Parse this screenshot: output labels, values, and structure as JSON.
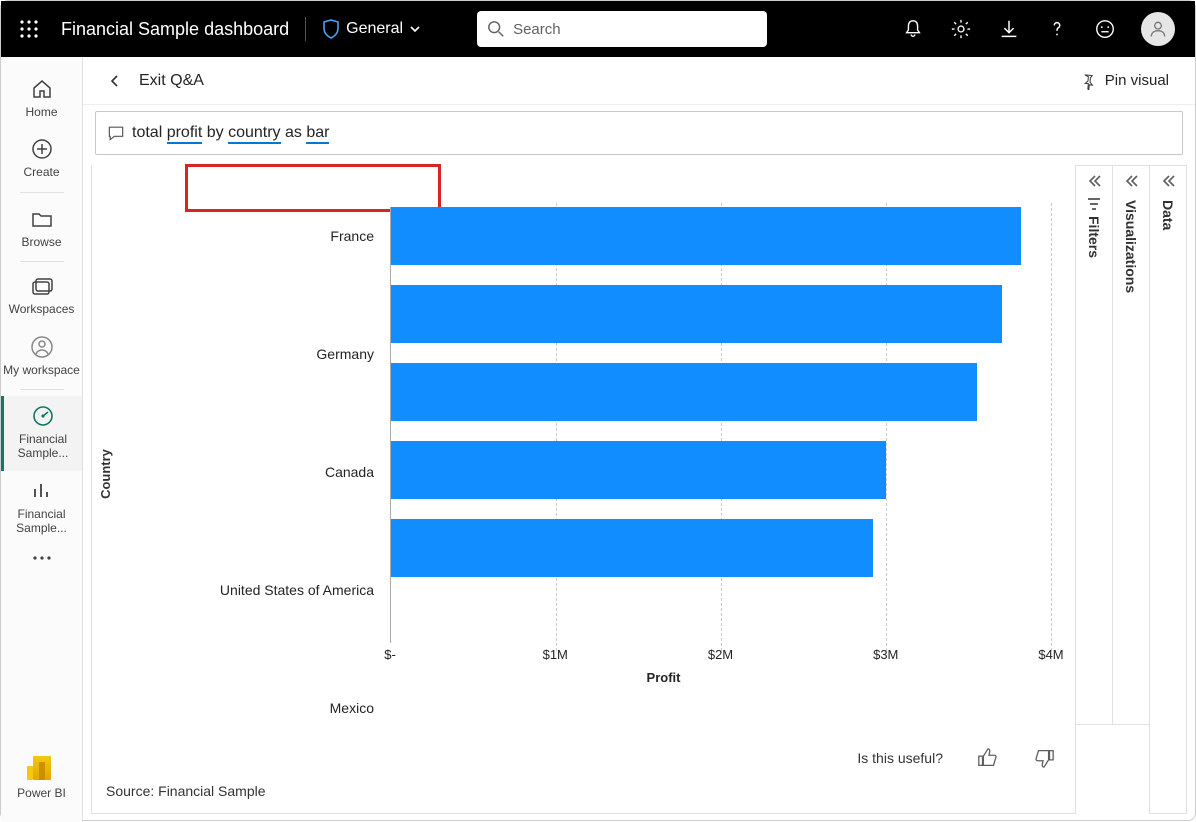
{
  "header": {
    "title": "Financial Sample dashboard",
    "sensitivity_label": "General",
    "search_placeholder": "Search"
  },
  "leftnav": {
    "items": [
      {
        "label": "Home"
      },
      {
        "label": "Create"
      },
      {
        "label": "Browse"
      },
      {
        "label": "Workspaces"
      },
      {
        "label": "My workspace"
      },
      {
        "label": "Financial Sample..."
      },
      {
        "label": "Financial Sample..."
      }
    ],
    "footer_label": "Power BI"
  },
  "subheader": {
    "exit_label": "Exit Q&A",
    "pin_label": "Pin visual"
  },
  "qna": {
    "tokens": [
      "total ",
      "profit",
      " by ",
      "country",
      " as ",
      "bar"
    ]
  },
  "right_panes": {
    "filters": "Filters",
    "viz": "Visualizations",
    "data": "Data"
  },
  "feedback": {
    "prompt": "Is this useful?"
  },
  "source_line": "Source: Financial Sample",
  "chart_data": {
    "type": "bar",
    "orientation": "horizontal",
    "ylabel": "Country",
    "xlabel": "Profit",
    "xlim": [
      0,
      4000000
    ],
    "xticks": [
      "$-",
      "$1M",
      "$2M",
      "$3M",
      "$4M"
    ],
    "categories": [
      "France",
      "Germany",
      "Canada",
      "United States of America",
      "Mexico"
    ],
    "values": [
      3820000,
      3700000,
      3550000,
      3000000,
      2920000
    ],
    "series_color": "#118dff"
  }
}
